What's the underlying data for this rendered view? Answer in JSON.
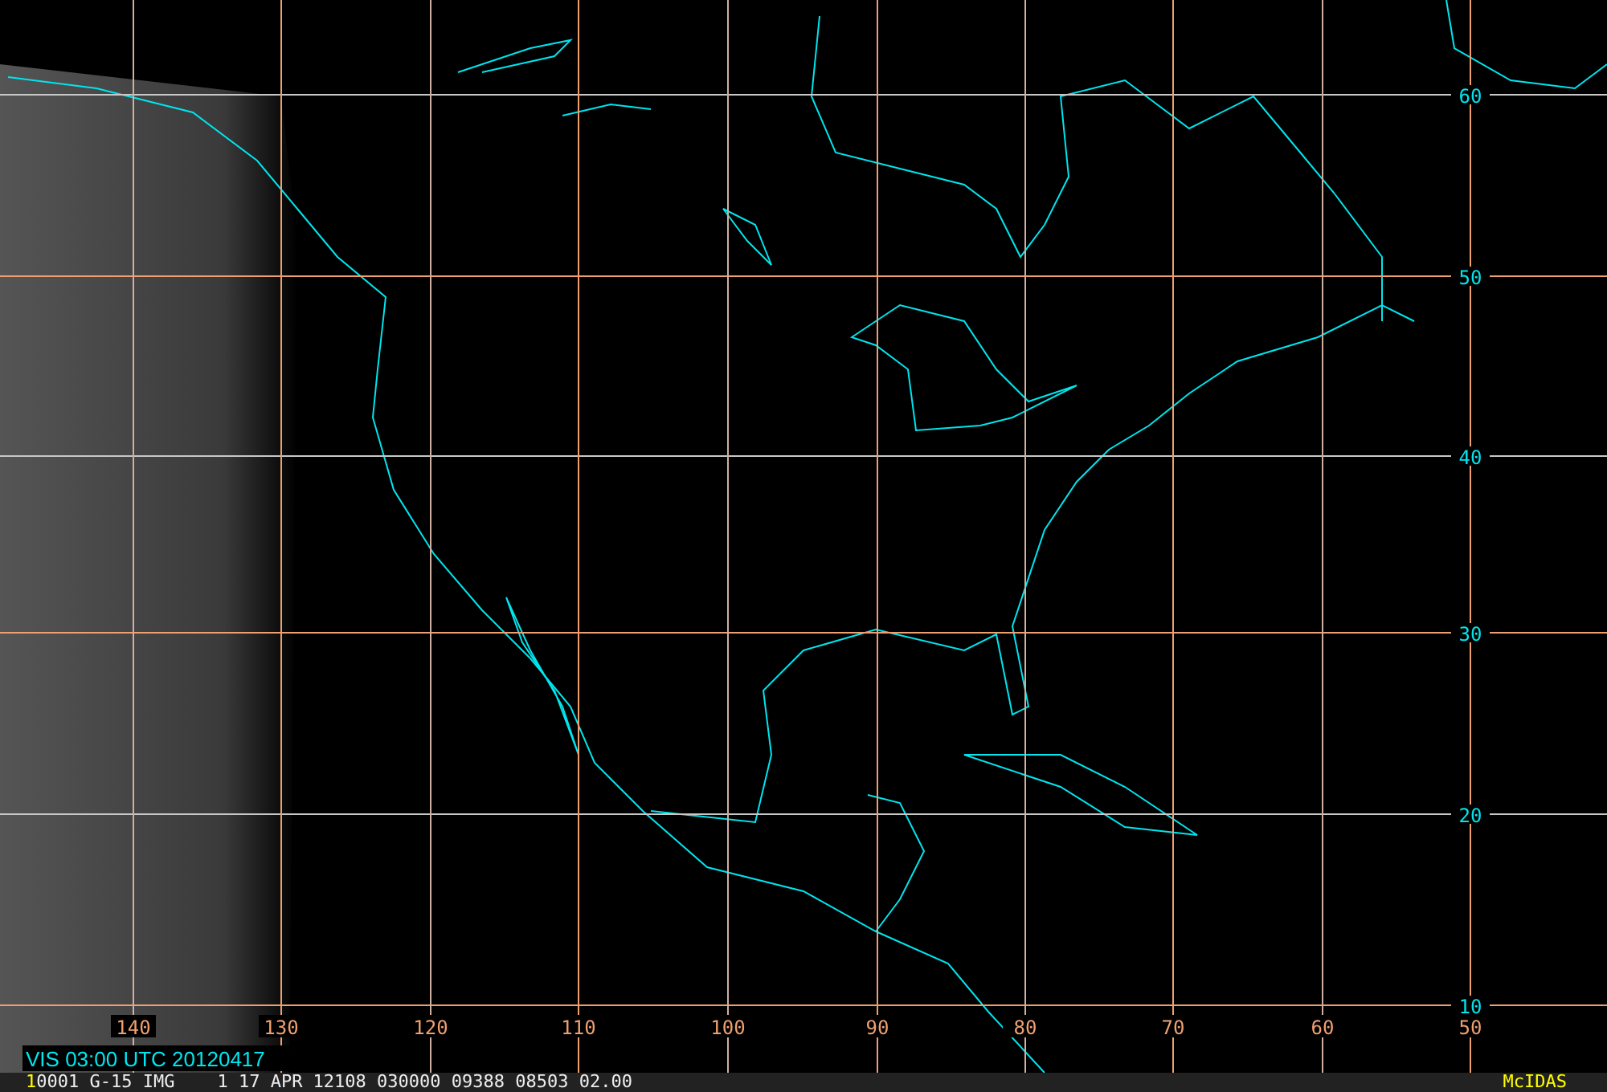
{
  "map": {
    "lat_labels": [
      "60",
      "50",
      "40",
      "30",
      "20",
      "10"
    ],
    "lon_labels": [
      "140",
      "130",
      "120",
      "110",
      "100",
      "90",
      "80",
      "70",
      "60",
      "50"
    ],
    "caption": "VIS 03:00 UTC 20120417"
  },
  "status_bar": {
    "frame": "1",
    "info": "0001 G-15 IMG    1 17 APR 12108 030000 09388 08503 02.00",
    "brand": "McIDAS"
  }
}
